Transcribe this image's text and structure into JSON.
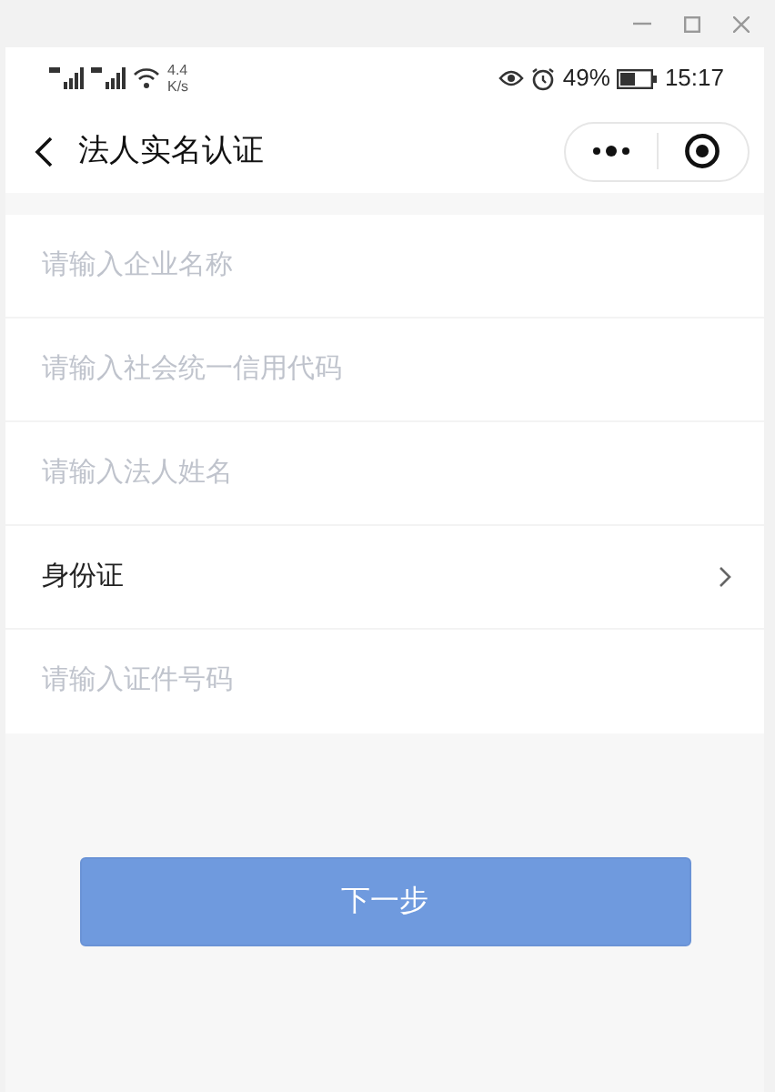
{
  "status_bar": {
    "speed_value": "4.4",
    "speed_unit": "K/s",
    "battery_percent": "49%",
    "time": "15:17"
  },
  "nav_bar": {
    "title": "法人实名认证"
  },
  "form_rows": [
    {
      "kind": "input",
      "placeholder": "请输入企业名称"
    },
    {
      "kind": "input",
      "placeholder": "请输入社会统一信用代码"
    },
    {
      "kind": "input",
      "placeholder": "请输入法人姓名"
    },
    {
      "kind": "select",
      "value": "身份证"
    },
    {
      "kind": "input",
      "placeholder": "请输入证件号码"
    }
  ],
  "next_button": {
    "label": "下一步",
    "disabled": true
  }
}
